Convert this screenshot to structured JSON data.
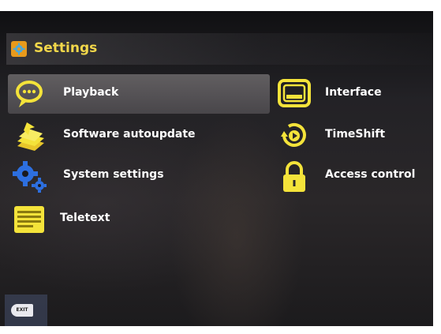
{
  "header": {
    "title": "Settings",
    "icon": "gear-icon"
  },
  "menu": {
    "left": [
      {
        "label": "Playback",
        "icon": "speech-bubble-icon",
        "selected": true
      },
      {
        "label": "Software autoupdate",
        "icon": "update-stack-icon",
        "selected": false
      },
      {
        "label": "System settings",
        "icon": "gears-icon",
        "selected": false
      },
      {
        "label": "Teletext",
        "icon": "teletext-icon",
        "selected": false
      }
    ],
    "right": [
      {
        "label": "Interface",
        "icon": "monitor-icon",
        "selected": false
      },
      {
        "label": "TimeShift",
        "icon": "timeshift-icon",
        "selected": false
      },
      {
        "label": "Access control",
        "icon": "padlock-icon",
        "selected": false
      }
    ]
  },
  "footer": {
    "exit_label": "EXIT",
    "exit_icon": "exit-key-icon"
  },
  "colors": {
    "accent": "#f2d74a",
    "icon_yellow": "#f4e33a",
    "header_icon_bg": "#e89a1c",
    "selection": "#6f6b6e",
    "text": "#ffffff"
  }
}
